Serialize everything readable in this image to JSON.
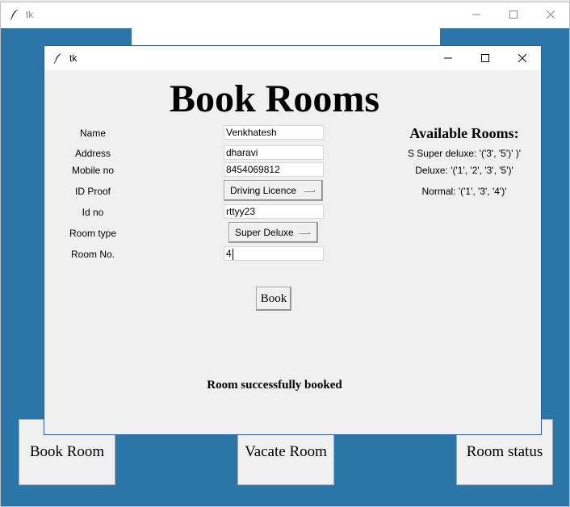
{
  "back_window": {
    "title": "tk",
    "buttons": {
      "book_room": "Book Room",
      "vacate_room": "Vacate Room",
      "room_status": "Room status"
    }
  },
  "front_window": {
    "title": "tk",
    "heading": "Book Rooms",
    "form": {
      "name_label": "Name",
      "name_value": "Venkhatesh",
      "address_label": "Address",
      "address_value": "dharavi",
      "mobile_label": "Mobile no",
      "mobile_value": "8454069812",
      "id_proof_label": "ID Proof",
      "id_proof_value": "Driving Licence",
      "id_no_label": "Id no",
      "id_no_value": "rttyy23",
      "room_type_label": "Room type",
      "room_type_value": "Super Deluxe",
      "room_no_label": "Room No.",
      "room_no_value": "4"
    },
    "available": {
      "title": "Available Rooms:",
      "super_deluxe": "S Super deluxe: '('3', '5')' )'",
      "deluxe": "Deluxe: '('1', '2', '3', '5')'",
      "normal": "Normal: '('1', '3', '4')'"
    },
    "book_label": "Book",
    "status": "Room successfully booked"
  },
  "colors": {
    "desktop_blue": "#2a76a8",
    "window_bg": "#f0f0f0",
    "front_border": "#2b5797"
  }
}
